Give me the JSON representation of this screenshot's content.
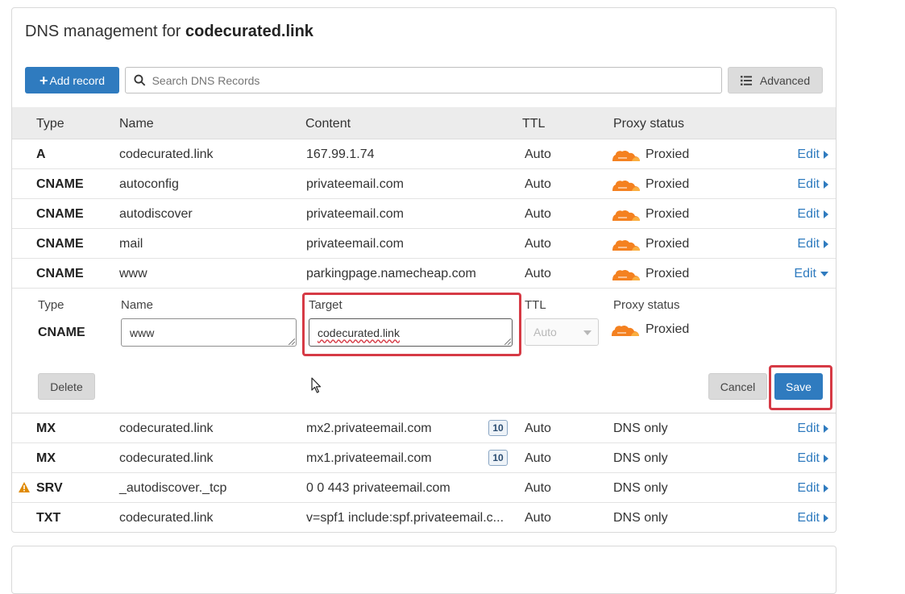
{
  "header": {
    "title_prefix": "DNS management for",
    "domain": "codecurated.link"
  },
  "toolbar": {
    "add_label": "Add record",
    "search_placeholder": "Search DNS Records",
    "advanced_label": "Advanced"
  },
  "columns": {
    "type": "Type",
    "name": "Name",
    "content": "Content",
    "ttl": "TTL",
    "proxy": "Proxy status"
  },
  "records_top": [
    {
      "type": "A",
      "name": "codecurated.link",
      "content": "167.99.1.74",
      "ttl": "Auto",
      "proxy": "Proxied",
      "edit": "Edit"
    },
    {
      "type": "CNAME",
      "name": "autoconfig",
      "content": "privateemail.com",
      "ttl": "Auto",
      "proxy": "Proxied",
      "edit": "Edit"
    },
    {
      "type": "CNAME",
      "name": "autodiscover",
      "content": "privateemail.com",
      "ttl": "Auto",
      "proxy": "Proxied",
      "edit": "Edit"
    },
    {
      "type": "CNAME",
      "name": "mail",
      "content": "privateemail.com",
      "ttl": "Auto",
      "proxy": "Proxied",
      "edit": "Edit"
    },
    {
      "type": "CNAME",
      "name": "www",
      "content": "parkingpage.namecheap.com",
      "ttl": "Auto",
      "proxy": "Proxied",
      "edit": "Edit"
    }
  ],
  "editor": {
    "type_label": "Type",
    "type_value": "CNAME",
    "name_label": "Name",
    "name_value": "www",
    "target_label": "Target",
    "target_value": "codecurated.link",
    "ttl_label": "TTL",
    "ttl_value": "Auto",
    "proxy_label": "Proxy status",
    "proxy_value": "Proxied",
    "delete_label": "Delete",
    "cancel_label": "Cancel",
    "save_label": "Save"
  },
  "records_bottom": [
    {
      "type": "MX",
      "name": "codecurated.link",
      "content": "mx2.privateemail.com",
      "priority": "10",
      "ttl": "Auto",
      "proxy": "DNS only",
      "edit": "Edit"
    },
    {
      "type": "MX",
      "name": "codecurated.link",
      "content": "mx1.privateemail.com",
      "priority": "10",
      "ttl": "Auto",
      "proxy": "DNS only",
      "edit": "Edit"
    },
    {
      "type": "SRV",
      "name": "_autodiscover._tcp",
      "content": "0 0 443 privateemail.com",
      "ttl": "Auto",
      "proxy": "DNS only",
      "edit": "Edit"
    },
    {
      "type": "TXT",
      "name": "codecurated.link",
      "content": "v=spf1 include:spf.privateemail.c...",
      "ttl": "Auto",
      "proxy": "DNS only",
      "edit": "Edit"
    }
  ],
  "colors": {
    "accent": "#2f7bbf",
    "cloud": "#f48120",
    "highlight": "#d63a45",
    "warning": "#e08a00"
  }
}
